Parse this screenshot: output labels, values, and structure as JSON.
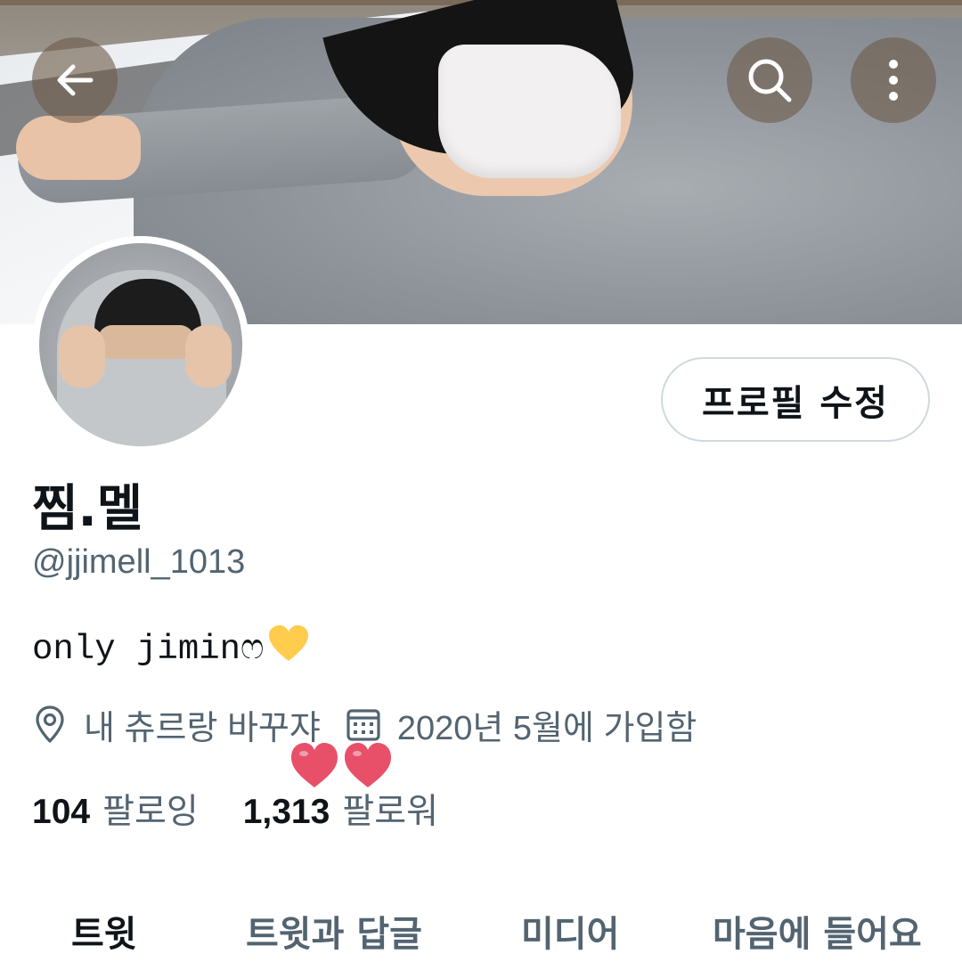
{
  "header": {
    "back_icon": "arrow-left-icon",
    "search_icon": "search-icon",
    "more_icon": "more-vertical-icon",
    "button_bg": "#6e5c4a"
  },
  "profile": {
    "edit_label": "프로필 수정",
    "display_name": "찜.멜",
    "handle": "@jjimell_1013",
    "bio_text": "only jiminෆ",
    "bio_emoji": "yellow-heart-icon",
    "location": "내 츄르랑 바꾸쟈",
    "location_icon": "location-pin-icon",
    "joined": "2020년 5월에 가입함",
    "joined_icon": "calendar-icon",
    "hearts_sticker": "red-hearts-icon"
  },
  "stats": {
    "following_count": "104",
    "following_label": "팔로잉",
    "followers_count": "1,313",
    "followers_label": "팔로워"
  },
  "tabs": [
    {
      "label": "트윗",
      "active": true
    },
    {
      "label": "트윗과 답글",
      "active": false
    },
    {
      "label": "미디어",
      "active": false
    },
    {
      "label": "마음에 들어요",
      "active": false
    }
  ],
  "colors": {
    "text_primary": "#0f1419",
    "text_secondary": "#536471",
    "border": "#cfd9de",
    "heart_yellow": "#ffcc4d",
    "heart_red": "#e8506a"
  }
}
